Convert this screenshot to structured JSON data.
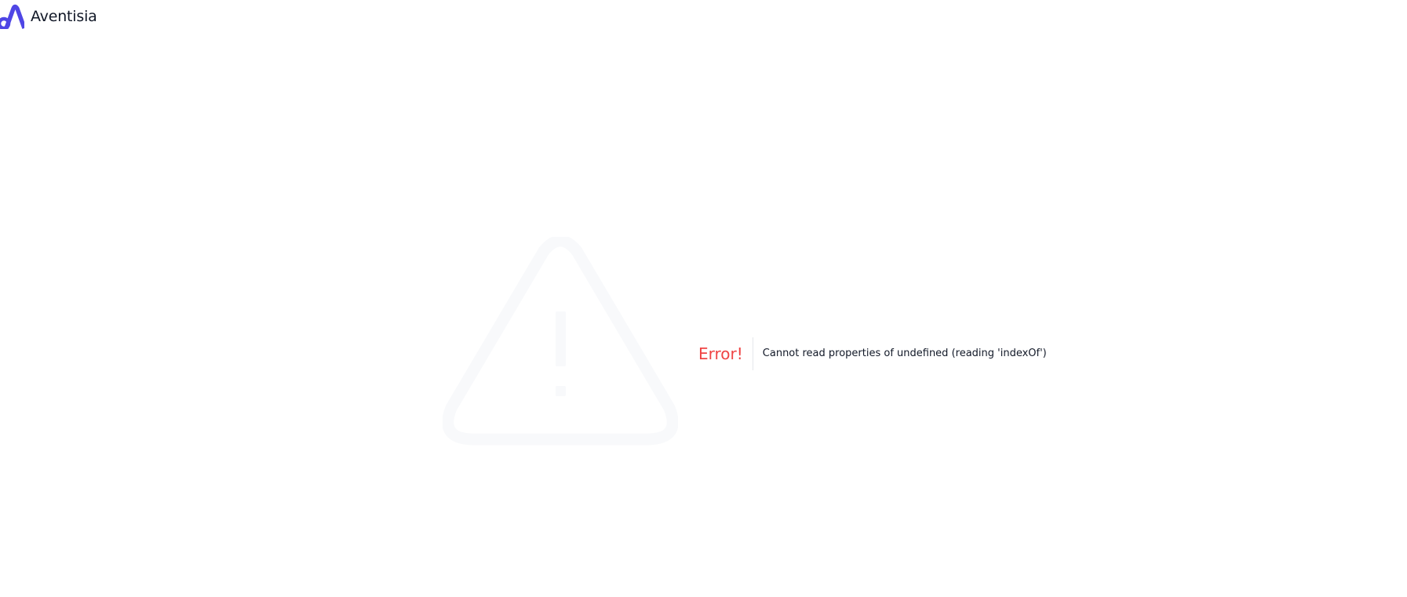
{
  "brand": {
    "name": "Aventisia",
    "logo_icon": "aventisia-logo-icon",
    "accent_color": "#4f46e5"
  },
  "error": {
    "title": "Error!",
    "message": "Cannot read properties of undefined (reading 'indexOf')",
    "title_color": "#ef4444",
    "illustration_icon": "warning-triangle-icon",
    "illustration_color": "#f8f9fb"
  }
}
